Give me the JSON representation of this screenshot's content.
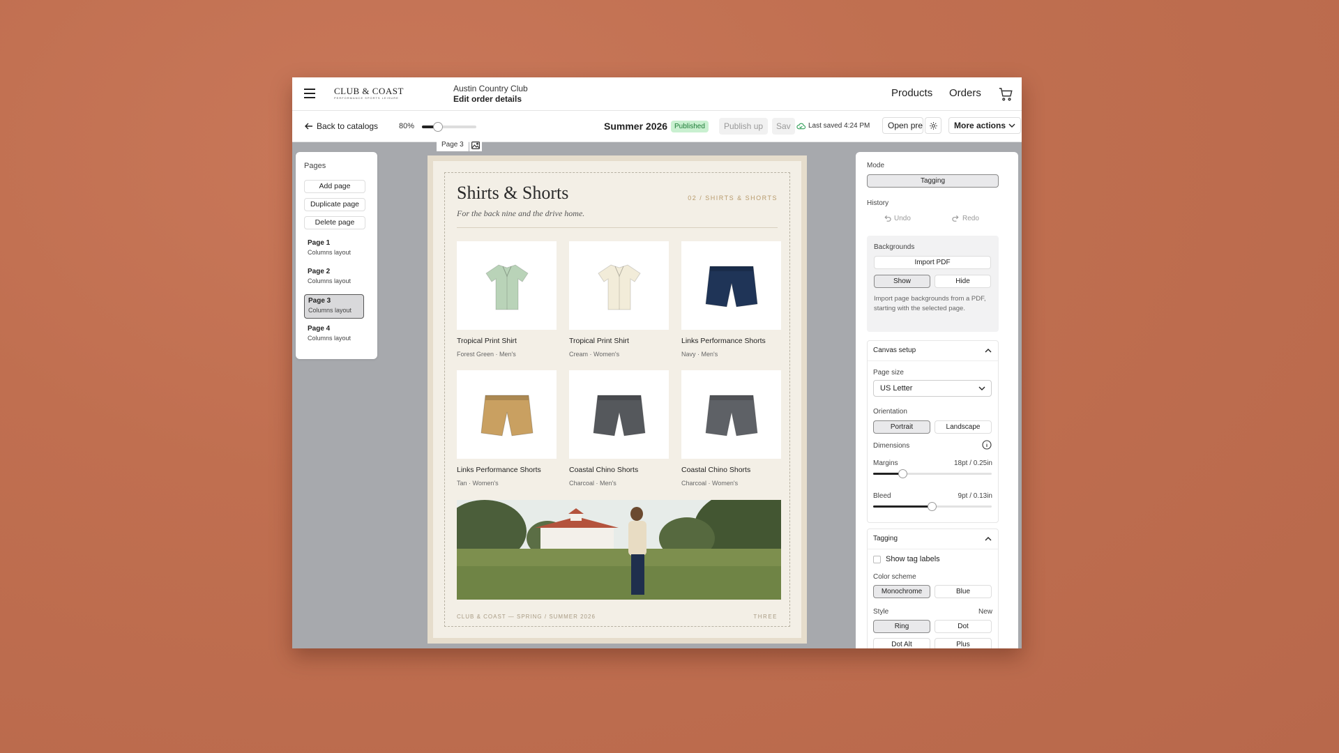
{
  "header": {
    "brand": "CLUB & COAST",
    "brand_tagline": "PERFORMANCE SPORTS LEISURE",
    "club_name": "Austin Country Club",
    "page_title": "Edit order details",
    "nav": {
      "products": "Products",
      "orders": "Orders"
    }
  },
  "toolbar": {
    "back_label": "Back to catalogs",
    "zoom_label": "80%",
    "zoom_level": 0.3,
    "catalog_title": "Summer 2026",
    "status_badge": "Published",
    "publish_label": "Publish up",
    "save_label": "Sav",
    "last_saved": "Last saved 4:24 PM",
    "open_preview_label": "Open pre",
    "more_actions_label": "More actions"
  },
  "pages_panel": {
    "title": "Pages",
    "add_label": "Add page",
    "duplicate_label": "Duplicate page",
    "delete_label": "Delete page",
    "pages": [
      {
        "name": "Page 1",
        "layout": "Columns layout"
      },
      {
        "name": "Page 2",
        "layout": "Columns layout"
      },
      {
        "name": "Page 3",
        "layout": "Columns layout"
      },
      {
        "name": "Page 4",
        "layout": "Columns layout"
      }
    ],
    "active_page": "Page 3"
  },
  "canvas": {
    "page_tab": "Page 3",
    "title": "Shirts & Shorts",
    "subtitle": "For the back nine and the drive home.",
    "section_label": "02 / SHIRTS & SHORTS",
    "products": [
      {
        "name": "Tropical Print Shirt",
        "details": "Forest Green · Men's",
        "color": "#b9d3b8",
        "kind": "shirt"
      },
      {
        "name": "Tropical Print Shirt",
        "details": "Cream · Women's",
        "color": "#f2ecd9",
        "kind": "shirt"
      },
      {
        "name": "Links Performance Shorts",
        "details": "Navy · Men's",
        "color": "#1f3457",
        "kind": "shorts"
      },
      {
        "name": "Links Performance Shorts",
        "details": "Tan · Women's",
        "color": "#c9a061",
        "kind": "shorts"
      },
      {
        "name": "Coastal Chino Shorts",
        "details": "Charcoal · Men's",
        "color": "#55585c",
        "kind": "shorts"
      },
      {
        "name": "Coastal Chino Shorts",
        "details": "Charcoal · Women's",
        "color": "#5e6166",
        "kind": "shorts"
      }
    ],
    "footer_left": "CLUB & COAST — SPRING / SUMMER 2026",
    "footer_right": "THREE"
  },
  "settings": {
    "mode_label": "Mode",
    "mode_value": "Tagging",
    "history_label": "History",
    "undo_label": "Undo",
    "redo_label": "Redo",
    "backgrounds": {
      "title": "Backgrounds",
      "import_label": "Import PDF",
      "show_label": "Show",
      "hide_label": "Hide",
      "help": "Import page backgrounds from a PDF, starting with the selected page."
    },
    "canvas_setup": {
      "title": "Canvas setup",
      "page_size_label": "Page size",
      "page_size_value": "US Letter",
      "orientation_label": "Orientation",
      "portrait_label": "Portrait",
      "landscape_label": "Landscape",
      "dimensions_label": "Dimensions",
      "margins_label": "Margins",
      "margins_value": "18pt / 0.25in",
      "margins_level": 0.25,
      "bleed_label": "Bleed",
      "bleed_value": "9pt / 0.13in",
      "bleed_level": 0.5
    },
    "tagging": {
      "title": "Tagging",
      "show_tag_labels": "Show tag labels",
      "color_scheme_label": "Color scheme",
      "monochrome_label": "Monochrome",
      "blue_label": "Blue",
      "style_label": "Style",
      "style_new_label": "New",
      "ring_label": "Ring",
      "dot_label": "Dot",
      "dot_alt_label": "Dot Alt",
      "plus_label": "Plus"
    }
  },
  "colors": {
    "background": "#c06f50",
    "published_bg": "#c9f0d0",
    "published_text": "#1c7a35",
    "accent_gold": "#b79a6b"
  }
}
